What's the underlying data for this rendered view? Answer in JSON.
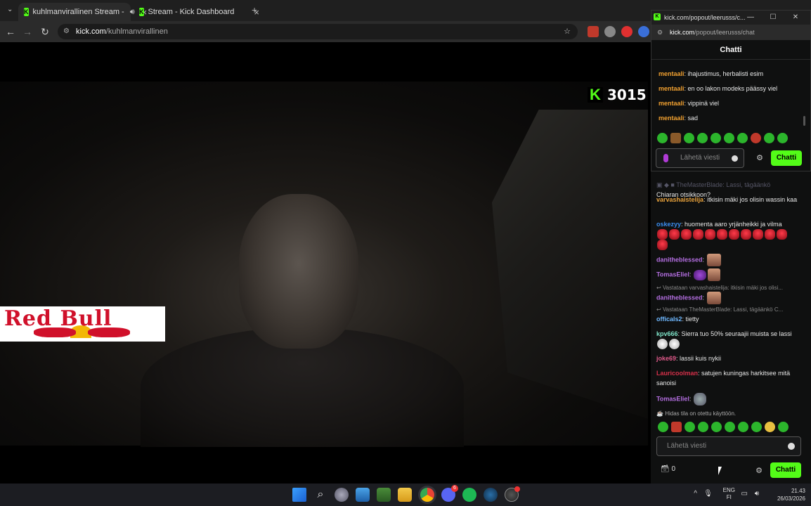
{
  "browser": {
    "tabs": [
      {
        "title": "kuhlmanvirallinen Stream -",
        "audio": true
      },
      {
        "title": "Stream - Kick Dashboard",
        "audio": false
      }
    ],
    "url_host": "kick.com",
    "url_path": "/kuhlmanvirallinen"
  },
  "video": {
    "viewer_count": "3015",
    "overlay_text": "Red Bull"
  },
  "popout": {
    "window_title": "kick.com/popout/leerusss/c...",
    "url_host": "kick.com",
    "url_path": "/popout/leerusss/chat",
    "header": "Chatti",
    "messages": [
      {
        "user": "mentaali",
        "text": "ihajustimus, herbalisti esim"
      },
      {
        "user": "mentaali",
        "text": "en oo lakon modeks päässy viel"
      },
      {
        "user": "mentaali",
        "text": "vippinä viel"
      },
      {
        "user": "mentaali",
        "text": "sad"
      }
    ],
    "input_placeholder": "Lähetä viesti",
    "send_label": "Chatti",
    "colors": {
      "user": "#f0a030",
      "accent": "#53fc18"
    }
  },
  "chat": {
    "top_message": {
      "text": "Chiaran otsikkoon?"
    },
    "messages": [
      {
        "user": "varvashaistelija",
        "color": "#e8a23c",
        "text": "itkisin mäki jos olisin wassin kaa"
      },
      {
        "user": "oskezyy",
        "color": "#3b8ef0",
        "text": "huomenta aaro yrjänheikki ja vilma"
      },
      {
        "user": "danitheblessed",
        "color": "#b36ee0",
        "text": ""
      },
      {
        "user": "TomasEliel",
        "color": "#b36ee0",
        "text": ""
      },
      {
        "reply": "Vastataan varvashaistelija: itkisin mäki jos olisi..."
      },
      {
        "user": "danitheblessed",
        "color": "#b36ee0",
        "text": ""
      },
      {
        "reply": "Vastataan TheMasterBlade: Lassi, tägäänkö C..."
      },
      {
        "user": "officals2",
        "color": "#6fb8ff",
        "text": "tietty"
      },
      {
        "user": "kpv666",
        "color": "#7fe3c8",
        "text": "Sierra tuo 50% seuraajii muista se lassi"
      },
      {
        "user": "joke69",
        "color": "#e05a8a",
        "text": "lassii kuis nykii"
      },
      {
        "user": "Lauricoolman",
        "color": "#d6304a",
        "text": "satujen kuningas harkitsee mitä sanoisi"
      },
      {
        "user": "TomasEliel",
        "color": "#b36ee0",
        "text": ""
      }
    ],
    "notice": "Hidas tila on otettu käyttöön.",
    "input_placeholder": "Lähetä viesti",
    "points": "0",
    "send_label": "Chatti"
  },
  "taskbar": {
    "lang_primary": "ENG",
    "lang_secondary": "FI",
    "time": "21.43",
    "date": "26/03/2026",
    "discord_badge": "6"
  }
}
